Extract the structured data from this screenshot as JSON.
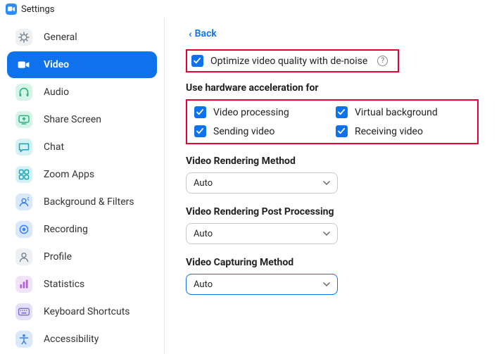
{
  "window": {
    "title": "Settings"
  },
  "sidebar": {
    "items": [
      {
        "label": "General"
      },
      {
        "label": "Video"
      },
      {
        "label": "Audio"
      },
      {
        "label": "Share Screen"
      },
      {
        "label": "Chat"
      },
      {
        "label": "Zoom Apps"
      },
      {
        "label": "Background & Filters"
      },
      {
        "label": "Recording"
      },
      {
        "label": "Profile"
      },
      {
        "label": "Statistics"
      },
      {
        "label": "Keyboard Shortcuts"
      },
      {
        "label": "Accessibility"
      }
    ]
  },
  "main": {
    "back": "Back",
    "denoise": {
      "label": "Optimize video quality with de-noise"
    },
    "hw_title": "Use hardware acceleration for",
    "hw": {
      "video_proc": "Video processing",
      "virtual_bg": "Virtual background",
      "sending": "Sending video",
      "receiving": "Receiving video"
    },
    "render_method": {
      "title": "Video Rendering Method",
      "value": "Auto"
    },
    "render_post": {
      "title": "Video Rendering Post Processing",
      "value": "Auto"
    },
    "capture": {
      "title": "Video Capturing Method",
      "value": "Auto"
    }
  }
}
